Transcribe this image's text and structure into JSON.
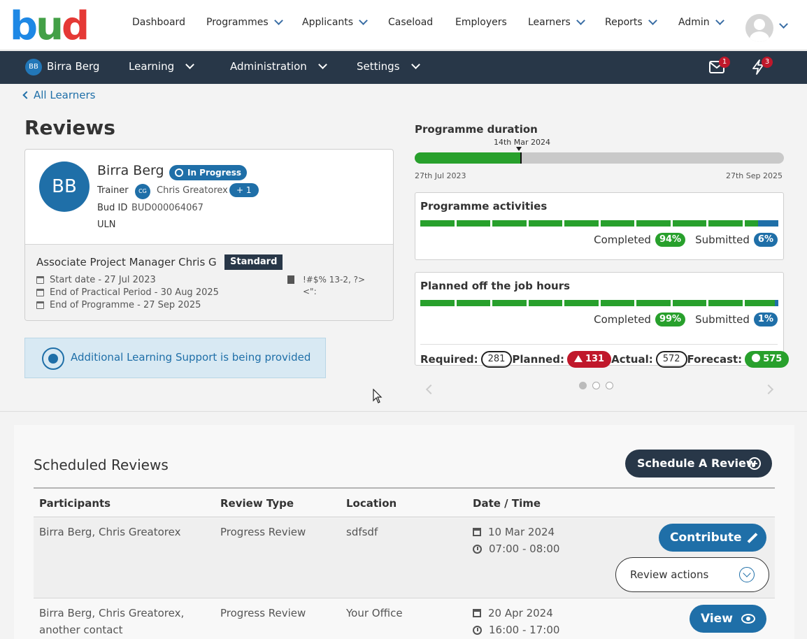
{
  "brand": {
    "logo_text_b": "b",
    "logo_text_u": "u",
    "logo_text_d": "d"
  },
  "topnav": {
    "items": [
      {
        "label": "Dashboard"
      },
      {
        "label": "Programmes"
      },
      {
        "label": "Applicants"
      },
      {
        "label": "Caseload"
      },
      {
        "label": "Employers"
      },
      {
        "label": "Learners"
      },
      {
        "label": "Reports"
      },
      {
        "label": "Admin"
      }
    ]
  },
  "subnav": {
    "initials": "BB",
    "name": "Birra Berg",
    "items": [
      {
        "label": "Learning"
      },
      {
        "label": "Administration"
      },
      {
        "label": "Settings"
      }
    ],
    "mail_count": "1",
    "alert_count": "3"
  },
  "page": {
    "back_label": "All Learners",
    "title": "Reviews"
  },
  "learner": {
    "initials": "BB",
    "name": "Birra Berg",
    "status": "In Progress",
    "trainer_label": "Trainer",
    "trainer_initials": "CG",
    "trainer_name": "Chris Greatorex",
    "trainer_extra": "+ 1",
    "bud_id_label": "Bud ID",
    "bud_id": "BUD000064067",
    "uln_label": "ULN",
    "programme": "Associate Project Manager Chris G",
    "programme_tag": "Standard",
    "start_date": "Start date - 27 Jul 2023",
    "end_practical": "End of Practical Period - 30 Aug 2025",
    "end_programme": "End of Programme - 27 Sep 2025",
    "location_line1": "!#$% 13-2, ?>",
    "location_line2": "<\":"
  },
  "support": {
    "text_prefix": "Additional Learning Support",
    "text_suffix": " is being provided"
  },
  "programme_duration": {
    "title": "Programme duration",
    "marker_label": "14th Mar 2024",
    "progress": 0.29,
    "start_label": "27th Jul 2023",
    "end_label": "27th Sep 2025"
  },
  "activities": {
    "title": "Programme activities",
    "completed_label": "Completed",
    "completed_value": "94%",
    "submitted_label": "Submitted",
    "submitted_value": "6%",
    "completed_fraction": 0.94,
    "submitted_fraction": 0.06
  },
  "otj_hours": {
    "title": "Planned off the job hours",
    "completed_label": "Completed",
    "completed_value": "99%",
    "submitted_label": "Submitted",
    "submitted_value": "1%",
    "completed_fraction": 0.99,
    "submitted_fraction": 0.01,
    "required_label": "Required:",
    "required_value": "281",
    "planned_label": "Planned:",
    "planned_value": "131",
    "actual_label": "Actual:",
    "actual_value": "572",
    "forecast_label": "Forecast:",
    "forecast_value": "575"
  },
  "carousel": {
    "slides": 3,
    "active": 0
  },
  "scheduled": {
    "title": "Scheduled Reviews",
    "schedule_button": "Schedule A Review",
    "columns": [
      "Participants",
      "Review Type",
      "Location",
      "Date / Time"
    ],
    "rows": [
      {
        "participants": "Birra Berg, Chris Greatorex",
        "type": "Progress Review",
        "location": "sdfsdf",
        "date": "10 Mar 2024",
        "time": "07:00 - 08:00",
        "primary_action": "Contribute",
        "secondary_action": "Review actions"
      },
      {
        "participants": "Birra Berg, Chris Greatorex, another contact",
        "type": "Progress Review",
        "location": "Your Office",
        "date": "20 Apr 2024",
        "time": "16:00 - 17:00",
        "primary_action": "View"
      }
    ]
  },
  "colors": {
    "navy": "#283748",
    "blue": "#1f6fa8",
    "green": "#28a02c",
    "red": "#c0182b"
  }
}
